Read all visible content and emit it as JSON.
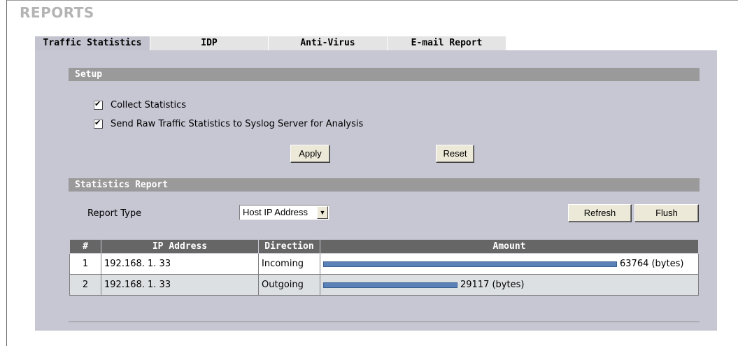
{
  "page": {
    "title": "REPORTS"
  },
  "tabs": [
    {
      "label": "Traffic Statistics",
      "active": true
    },
    {
      "label": "IDP",
      "active": false
    },
    {
      "label": "Anti-Virus",
      "active": false
    },
    {
      "label": "E-mail Report",
      "active": false
    }
  ],
  "setup": {
    "section_title": "Setup",
    "collect_statistics": {
      "label": "Collect Statistics",
      "checked": true
    },
    "send_syslog": {
      "label": "Send Raw Traffic Statistics to Syslog Server for Analysis",
      "checked": true
    },
    "apply_label": "Apply",
    "reset_label": "Reset"
  },
  "report": {
    "section_title": "Statistics Report",
    "report_type_label": "Report Type",
    "report_type_value": "Host IP Address",
    "refresh_label": "Refresh",
    "flush_label": "Flush",
    "columns": {
      "num": "#",
      "ip": "IP Address",
      "direction": "Direction",
      "amount": "Amount"
    },
    "rows": [
      {
        "num": "1",
        "ip": "192.168. 1. 33",
        "direction": "Incoming",
        "amount_text": "63764 (bytes)",
        "amount_bytes": 63764
      },
      {
        "num": "2",
        "ip": "192.168. 1. 33",
        "direction": "Outgoing",
        "amount_text": "29117 (bytes)",
        "amount_bytes": 29117
      }
    ]
  },
  "colors": {
    "panel": "#c7c6d3",
    "section_bar": "#9b9a9a",
    "header": "#666666",
    "bar": "#5a82b8"
  }
}
